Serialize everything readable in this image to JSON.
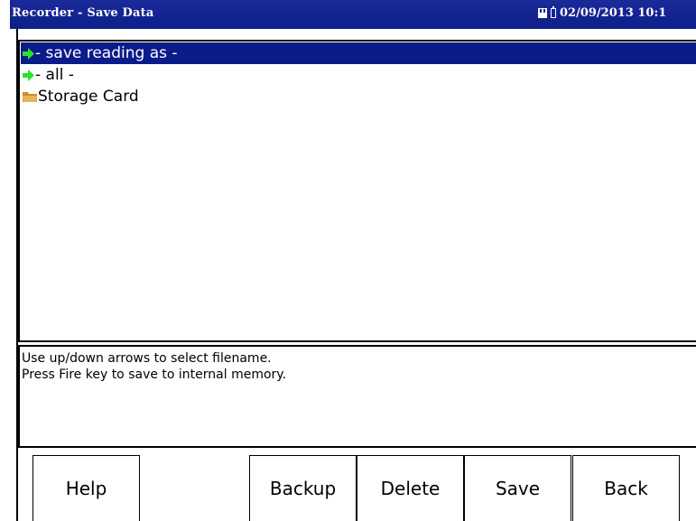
{
  "window": {
    "title": "Recorder - Save Data",
    "datetime": "02/09/2013 10:1⁠"
  },
  "status_icons": [
    "sd-card-icon",
    "battery-icon"
  ],
  "file_list": {
    "items": [
      {
        "label": "- save reading as -",
        "icon": "green-arrow-icon",
        "selected": true
      },
      {
        "label": "- all -",
        "icon": "green-arrow-icon",
        "selected": false
      },
      {
        "label": "Storage Card",
        "icon": "folder-icon",
        "selected": false
      }
    ]
  },
  "help": {
    "line1": "Use up/down arrows to select filename.",
    "line2": "Press Fire key to save to internal memory."
  },
  "softkeys": {
    "help": "Help",
    "backup": "Backup",
    "delete": "Delete",
    "save": "Save",
    "back": "Back"
  },
  "colors": {
    "titlebar": "#0d1f8a",
    "selection": "#0c1b8a",
    "arrow": "#2ee02e",
    "folder": "#d9a441"
  }
}
